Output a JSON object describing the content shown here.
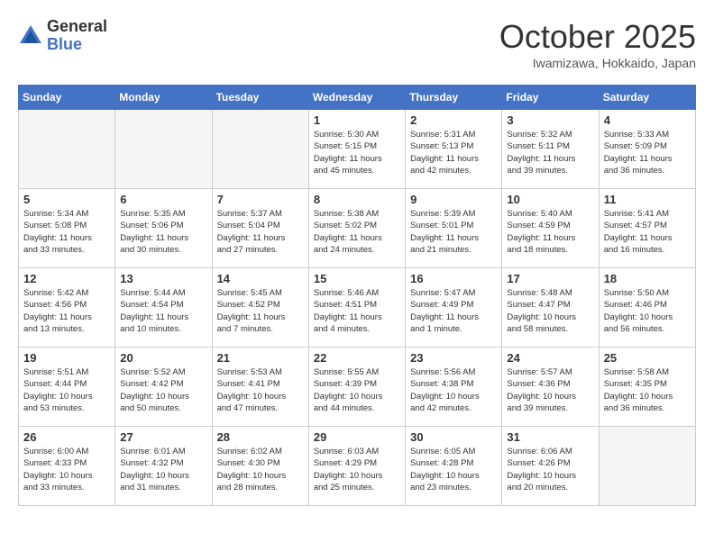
{
  "header": {
    "logo_general": "General",
    "logo_blue": "Blue",
    "month_title": "October 2025",
    "subtitle": "Iwamizawa, Hokkaido, Japan"
  },
  "days_of_week": [
    "Sunday",
    "Monday",
    "Tuesday",
    "Wednesday",
    "Thursday",
    "Friday",
    "Saturday"
  ],
  "weeks": [
    [
      {
        "day": "",
        "info": ""
      },
      {
        "day": "",
        "info": ""
      },
      {
        "day": "",
        "info": ""
      },
      {
        "day": "1",
        "info": "Sunrise: 5:30 AM\nSunset: 5:15 PM\nDaylight: 11 hours\nand 45 minutes."
      },
      {
        "day": "2",
        "info": "Sunrise: 5:31 AM\nSunset: 5:13 PM\nDaylight: 11 hours\nand 42 minutes."
      },
      {
        "day": "3",
        "info": "Sunrise: 5:32 AM\nSunset: 5:11 PM\nDaylight: 11 hours\nand 39 minutes."
      },
      {
        "day": "4",
        "info": "Sunrise: 5:33 AM\nSunset: 5:09 PM\nDaylight: 11 hours\nand 36 minutes."
      }
    ],
    [
      {
        "day": "5",
        "info": "Sunrise: 5:34 AM\nSunset: 5:08 PM\nDaylight: 11 hours\nand 33 minutes."
      },
      {
        "day": "6",
        "info": "Sunrise: 5:35 AM\nSunset: 5:06 PM\nDaylight: 11 hours\nand 30 minutes."
      },
      {
        "day": "7",
        "info": "Sunrise: 5:37 AM\nSunset: 5:04 PM\nDaylight: 11 hours\nand 27 minutes."
      },
      {
        "day": "8",
        "info": "Sunrise: 5:38 AM\nSunset: 5:02 PM\nDaylight: 11 hours\nand 24 minutes."
      },
      {
        "day": "9",
        "info": "Sunrise: 5:39 AM\nSunset: 5:01 PM\nDaylight: 11 hours\nand 21 minutes."
      },
      {
        "day": "10",
        "info": "Sunrise: 5:40 AM\nSunset: 4:59 PM\nDaylight: 11 hours\nand 18 minutes."
      },
      {
        "day": "11",
        "info": "Sunrise: 5:41 AM\nSunset: 4:57 PM\nDaylight: 11 hours\nand 16 minutes."
      }
    ],
    [
      {
        "day": "12",
        "info": "Sunrise: 5:42 AM\nSunset: 4:56 PM\nDaylight: 11 hours\nand 13 minutes."
      },
      {
        "day": "13",
        "info": "Sunrise: 5:44 AM\nSunset: 4:54 PM\nDaylight: 11 hours\nand 10 minutes."
      },
      {
        "day": "14",
        "info": "Sunrise: 5:45 AM\nSunset: 4:52 PM\nDaylight: 11 hours\nand 7 minutes."
      },
      {
        "day": "15",
        "info": "Sunrise: 5:46 AM\nSunset: 4:51 PM\nDaylight: 11 hours\nand 4 minutes."
      },
      {
        "day": "16",
        "info": "Sunrise: 5:47 AM\nSunset: 4:49 PM\nDaylight: 11 hours\nand 1 minute."
      },
      {
        "day": "17",
        "info": "Sunrise: 5:48 AM\nSunset: 4:47 PM\nDaylight: 10 hours\nand 58 minutes."
      },
      {
        "day": "18",
        "info": "Sunrise: 5:50 AM\nSunset: 4:46 PM\nDaylight: 10 hours\nand 56 minutes."
      }
    ],
    [
      {
        "day": "19",
        "info": "Sunrise: 5:51 AM\nSunset: 4:44 PM\nDaylight: 10 hours\nand 53 minutes."
      },
      {
        "day": "20",
        "info": "Sunrise: 5:52 AM\nSunset: 4:42 PM\nDaylight: 10 hours\nand 50 minutes."
      },
      {
        "day": "21",
        "info": "Sunrise: 5:53 AM\nSunset: 4:41 PM\nDaylight: 10 hours\nand 47 minutes."
      },
      {
        "day": "22",
        "info": "Sunrise: 5:55 AM\nSunset: 4:39 PM\nDaylight: 10 hours\nand 44 minutes."
      },
      {
        "day": "23",
        "info": "Sunrise: 5:56 AM\nSunset: 4:38 PM\nDaylight: 10 hours\nand 42 minutes."
      },
      {
        "day": "24",
        "info": "Sunrise: 5:57 AM\nSunset: 4:36 PM\nDaylight: 10 hours\nand 39 minutes."
      },
      {
        "day": "25",
        "info": "Sunrise: 5:58 AM\nSunset: 4:35 PM\nDaylight: 10 hours\nand 36 minutes."
      }
    ],
    [
      {
        "day": "26",
        "info": "Sunrise: 6:00 AM\nSunset: 4:33 PM\nDaylight: 10 hours\nand 33 minutes."
      },
      {
        "day": "27",
        "info": "Sunrise: 6:01 AM\nSunset: 4:32 PM\nDaylight: 10 hours\nand 31 minutes."
      },
      {
        "day": "28",
        "info": "Sunrise: 6:02 AM\nSunset: 4:30 PM\nDaylight: 10 hours\nand 28 minutes."
      },
      {
        "day": "29",
        "info": "Sunrise: 6:03 AM\nSunset: 4:29 PM\nDaylight: 10 hours\nand 25 minutes."
      },
      {
        "day": "30",
        "info": "Sunrise: 6:05 AM\nSunset: 4:28 PM\nDaylight: 10 hours\nand 23 minutes."
      },
      {
        "day": "31",
        "info": "Sunrise: 6:06 AM\nSunset: 4:26 PM\nDaylight: 10 hours\nand 20 minutes."
      },
      {
        "day": "",
        "info": ""
      }
    ]
  ]
}
